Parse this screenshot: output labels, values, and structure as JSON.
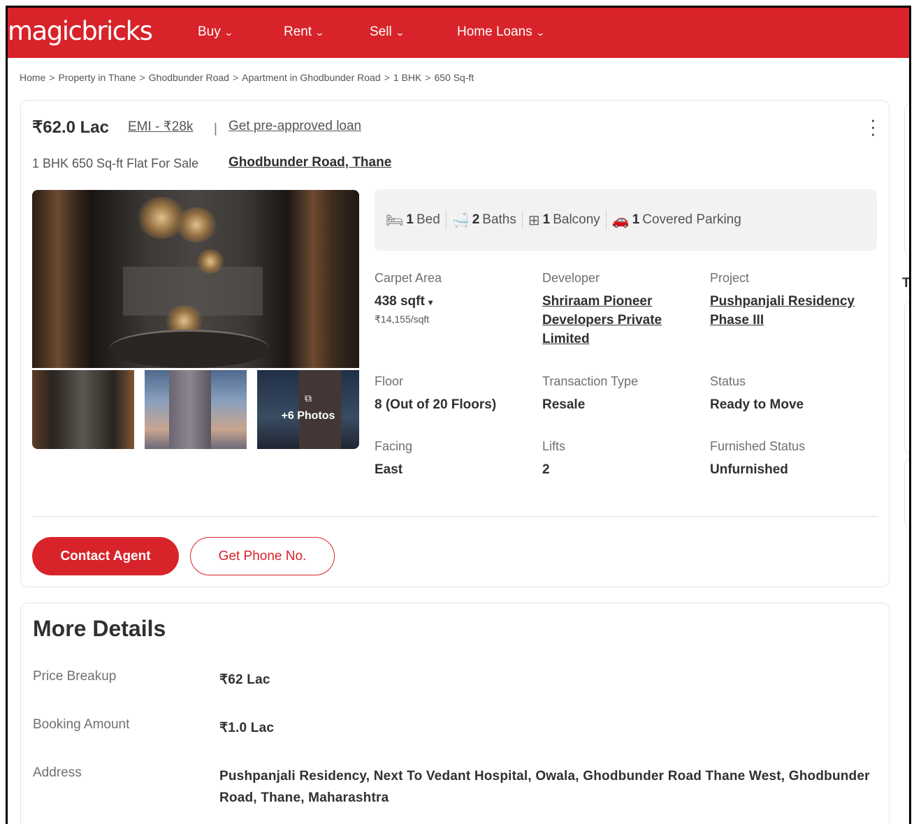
{
  "header": {
    "logo": "magicbricks",
    "nav": [
      {
        "label": "Buy"
      },
      {
        "label": "Rent"
      },
      {
        "label": "Sell"
      },
      {
        "label": "Home Loans"
      }
    ],
    "brand_color": "#d8232a"
  },
  "breadcrumb": [
    "Home",
    "Property in Thane",
    "Ghodbunder Road",
    "Apartment in Ghodbunder Road",
    "1 BHK",
    "650 Sq-ft"
  ],
  "listing": {
    "price": "₹62.0 Lac",
    "emi": "EMI - ₹28k",
    "separator": "|",
    "loan_link": "Get pre-approved loan",
    "subtitle": "1 BHK 650 Sq-ft Flat For Sale",
    "location": "Ghodbunder Road, Thane",
    "photos_more": "+6 Photos",
    "amenities": [
      {
        "icon": "bed-icon",
        "count": "1",
        "label": "Bed"
      },
      {
        "icon": "bathtub-icon",
        "count": "2",
        "label": "Baths"
      },
      {
        "icon": "balcony-icon",
        "count": "1",
        "label": "Balcony"
      },
      {
        "icon": "car-icon",
        "count": "1",
        "label": "Covered Parking"
      }
    ],
    "specs": {
      "carpet_area": {
        "label": "Carpet Area",
        "value": "438 sqft",
        "sub": "₹14,155/sqft"
      },
      "developer": {
        "label": "Developer",
        "value": "Shriraam Pioneer Developers Private Limited"
      },
      "project": {
        "label": "Project",
        "value": "Pushpanjali Residency Phase III"
      },
      "floor": {
        "label": "Floor",
        "value": "8 (Out of 20 Floors)"
      },
      "transaction": {
        "label": "Transaction Type",
        "value": "Resale"
      },
      "status": {
        "label": "Status",
        "value": "Ready to Move"
      },
      "facing": {
        "label": "Facing",
        "value": "East"
      },
      "lifts": {
        "label": "Lifts",
        "value": "2"
      },
      "furnished": {
        "label": "Furnished Status",
        "value": "Unfurnished"
      }
    },
    "buttons": {
      "contact": "Contact Agent",
      "phone": "Get Phone No."
    }
  },
  "more_details": {
    "title": "More Details",
    "rows": [
      {
        "key": "Price Breakup",
        "value": "₹62 Lac"
      },
      {
        "key": "Booking Amount",
        "value": "₹1.0 Lac"
      },
      {
        "key": "Address",
        "value": "Pushpanjali Residency, Next To Vedant Hospital, Owala, Ghodbunder Road Thane West, Ghodbunder Road, Thane, Maharashtra"
      }
    ]
  },
  "right_panel_partial": "To"
}
